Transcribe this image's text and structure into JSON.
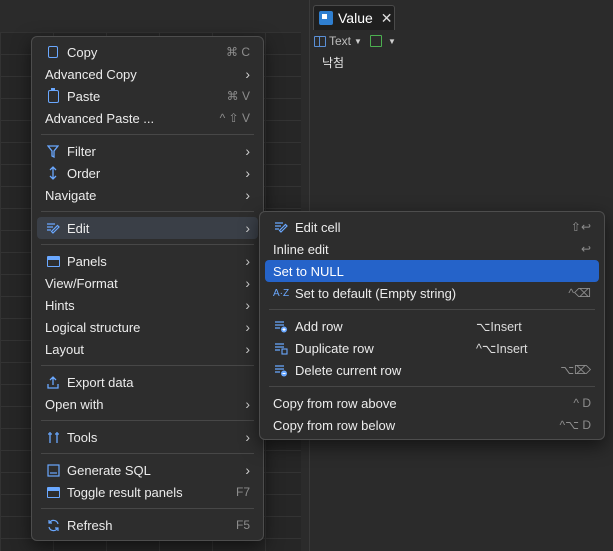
{
  "value_panel": {
    "tab_label": "Value",
    "close_glyph": "✕",
    "toolbar": {
      "text_label": "Text"
    },
    "content": "낙첨"
  },
  "main_menu": {
    "items": [
      {
        "label": "Copy",
        "shortcut": "⌘ C",
        "icon": "copy-icon"
      },
      {
        "label": "Advanced Copy",
        "submenu": true
      },
      {
        "label": "Paste",
        "shortcut": "⌘ V",
        "icon": "paste-icon"
      },
      {
        "label": "Advanced Paste ...",
        "shortcut": "^ ⇧ V"
      },
      {
        "label": "Filter",
        "submenu": true,
        "icon": "filter-icon"
      },
      {
        "label": "Order",
        "submenu": true,
        "icon": "order-icon"
      },
      {
        "label": "Navigate",
        "submenu": true
      },
      {
        "label": "Edit",
        "submenu": true,
        "icon": "edit-icon"
      },
      {
        "label": "Panels",
        "submenu": true,
        "icon": "panels-icon"
      },
      {
        "label": "View/Format",
        "submenu": true
      },
      {
        "label": "Hints",
        "submenu": true
      },
      {
        "label": "Logical structure",
        "submenu": true
      },
      {
        "label": "Layout",
        "submenu": true
      },
      {
        "label": "Export data",
        "icon": "export-icon"
      },
      {
        "label": "Open with",
        "submenu": true
      },
      {
        "label": "Tools",
        "submenu": true,
        "icon": "tools-icon"
      },
      {
        "label": "Generate SQL",
        "submenu": true,
        "icon": "sql-icon"
      },
      {
        "label": "Toggle result panels",
        "shortcut": "F7",
        "icon": "toggle-panels-icon"
      },
      {
        "label": "Refresh",
        "shortcut": "F5",
        "icon": "refresh-icon"
      }
    ],
    "arrow": "›"
  },
  "edit_submenu": {
    "items": [
      {
        "label": "Edit cell",
        "shortcut": "⇧↩"
      },
      {
        "label": "Inline edit",
        "shortcut": "↩"
      },
      {
        "label": "Set to NULL"
      },
      {
        "label": "Set to default (Empty string)",
        "shortcut": "^⌫"
      },
      {
        "label": "Add row",
        "shortcut": "⌥Insert"
      },
      {
        "label": "Duplicate row",
        "shortcut": "^⌥Insert"
      },
      {
        "label": "Delete current row",
        "shortcut": "⌥⌦"
      },
      {
        "label": "Copy from row above",
        "shortcut": "^ D"
      },
      {
        "label": "Copy from row below",
        "shortcut": "^⌥ D"
      }
    ]
  },
  "colors": {
    "selection": "#2563c9",
    "accent_icon": "#6aa8ff",
    "menu_bg": "#2d2d2d"
  }
}
